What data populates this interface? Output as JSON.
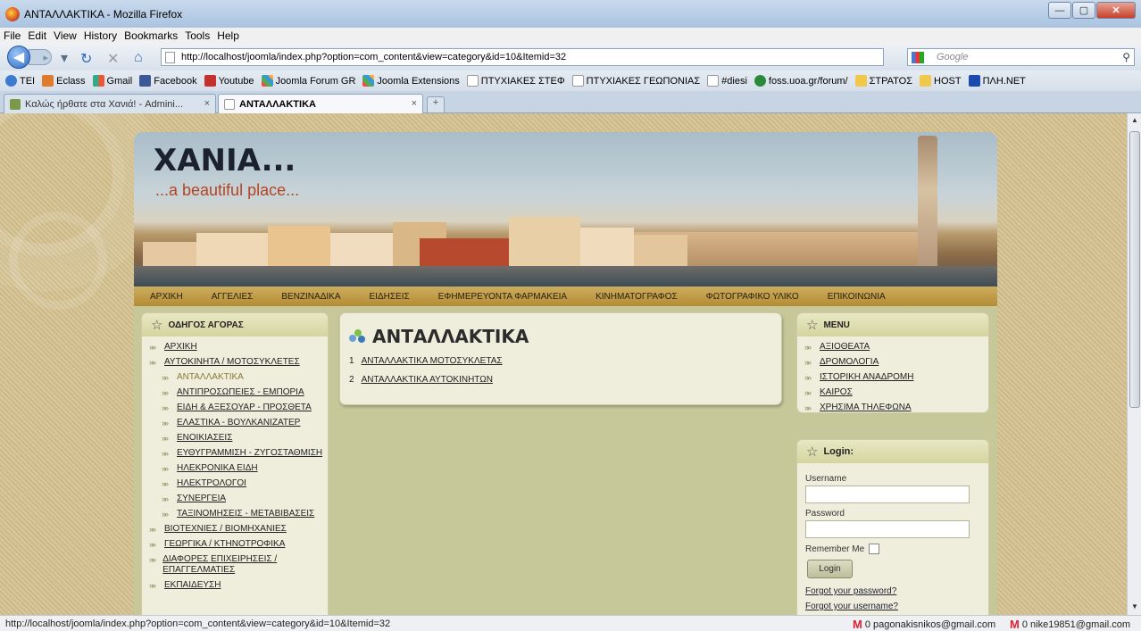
{
  "window": {
    "title": "ΑΝΤΑΛΛΑΚΤΙΚΑ - Mozilla Firefox"
  },
  "menubar": [
    "File",
    "Edit",
    "View",
    "History",
    "Bookmarks",
    "Tools",
    "Help"
  ],
  "nav": {
    "url": "http://localhost/joomla/index.php?option=com_content&view=category&id=10&Itemid=32",
    "search_placeholder": "Google"
  },
  "bookmarks": [
    {
      "label": "TEI",
      "icon": "blue-globe-icon"
    },
    {
      "label": "Eclass",
      "icon": "eclass-icon"
    },
    {
      "label": "Gmail",
      "icon": "gmail-icon"
    },
    {
      "label": "Facebook",
      "icon": "facebook-icon"
    },
    {
      "label": "Youtube",
      "icon": "youtube-icon"
    },
    {
      "label": "Joomla Forum GR",
      "icon": "joomla-icon"
    },
    {
      "label": "Joomla Extensions",
      "icon": "joomla-icon"
    },
    {
      "label": "ΠΤΥΧΙΑΚΕΣ ΣΤΕΦ",
      "icon": "page-icon"
    },
    {
      "label": "ΠΤΥΧΙΑΚΕΣ ΓΕΩΠΟΝΙΑΣ",
      "icon": "page-icon"
    },
    {
      "label": "#diesi",
      "icon": "page-icon"
    },
    {
      "label": "foss.uoa.gr/forum/",
      "icon": "foss-icon"
    },
    {
      "label": "ΣΤΡΑΤΟΣ",
      "icon": "folder-icon"
    },
    {
      "label": "HOST",
      "icon": "folder-icon"
    },
    {
      "label": "ΠΛΗ.ΝΕΤ",
      "icon": "fl-icon"
    }
  ],
  "tabs": [
    {
      "label": "Καλώς ήρθατε στα Χανιά! - Admini...",
      "active": false
    },
    {
      "label": "ΑΝΤΑΛΛΑΚΤΙΚΑ",
      "active": true
    }
  ],
  "site": {
    "title": "XANIA...",
    "subtitle": "...a beautiful place...",
    "topnav": [
      "ΑΡΧΙΚΗ",
      "ΑΓΓΕΛΙΕΣ",
      "ΒΕΝΖΙΝΑΔΙΚΑ",
      "ΕΙΔΗΣΕΙΣ",
      "ΕΦΗΜΕΡΕΥΟΝΤΑ ΦΑΡΜΑΚΕΙΑ",
      "ΚΙΝΗΜΑΤΟΓΡΑΦΟΣ",
      "ΦΩΤΟΓΡΑΦΙΚΟ ΥΛΙΚΟ",
      "ΕΠΙΚΟΙΝΩΝΙΑ"
    ]
  },
  "left_menu": {
    "title": "ΟΔΗΓΟΣ ΑΓΟΡΑΣ",
    "items": [
      {
        "label": "ΑΡΧΙΚΗ",
        "level": 0
      },
      {
        "label": "ΑΥΤΟΚΙΝΗΤΑ / ΜΟΤΟΣΥΚΛΕΤΕΣ",
        "level": 0
      },
      {
        "label": "ΑΝΤΑΛΛΑΚΤΙΚΑ",
        "level": 1,
        "active": true
      },
      {
        "label": "ΑΝΤΙΠΡΟΣΩΠΕΙΕΣ - ΕΜΠΟΡΙΑ",
        "level": 1
      },
      {
        "label": "ΕΙΔΗ & ΑΞΕΣΟΥΑΡ - ΠΡΟΣΘΕΤΑ",
        "level": 1
      },
      {
        "label": "ΕΛΑΣΤΙΚΑ - ΒΟΥΛΚΑΝΙΖΑΤΕΡ",
        "level": 1
      },
      {
        "label": "ΕΝΟΙΚΙΑΣΕΙΣ",
        "level": 1
      },
      {
        "label": "ΕΥΘΥΓΡΑΜΜΙΣΗ - ΖΥΓΟΣΤΑΘΜΙΣΗ",
        "level": 1
      },
      {
        "label": "ΗΛΕΚΡΟΝΙΚΑ ΕΙΔΗ",
        "level": 1
      },
      {
        "label": "ΗΛΕΚΤΡΟΛΟΓΟΙ",
        "level": 1
      },
      {
        "label": "ΣΥΝΕΡΓΕΙΑ",
        "level": 1
      },
      {
        "label": "ΤΑΞΙΝΟΜΗΣΕΙΣ - ΜΕΤΑΒΙΒΑΣΕΙΣ",
        "level": 1
      },
      {
        "label": "ΒΙΟΤΕΧΝΙΕΣ / ΒΙΟΜΗΧΑΝΙΕΣ",
        "level": 0
      },
      {
        "label": "ΓΕΩΡΓΙΚΑ / ΚΤΗΝΟΤΡΟΦΙΚΑ",
        "level": 0
      },
      {
        "label": "ΔΙΑΦΟΡΕΣ ΕΠΙΧΕΙΡΗΣΕΙΣ / ΕΠΑΓΓΕΛΜΑΤΙΕΣ",
        "level": 0
      },
      {
        "label": "ΕΚΠΑΙΔΕΥΣΗ",
        "level": 0
      }
    ]
  },
  "content": {
    "title": "ΑΝΤΑΛΛΑΚΤΙΚΑ",
    "items": [
      {
        "num": "1",
        "label": "ΑΝΤΑΛΛΑΚΤΙΚΑ ΜΟΤΟΣΥΚΛΕΤΑΣ"
      },
      {
        "num": "2",
        "label": "ΑΝΤΑΛΛΑΚΤΙΚΑ ΑΥΤΟΚΙΝΗΤΩΝ"
      }
    ]
  },
  "right_menu": {
    "title": "MENU",
    "items": [
      "ΑΞΙΟΘΕΑΤΑ",
      "ΔΡΟΜΟΛΟΓΙΑ",
      "ΙΣΤΟΡΙΚΗ ΑΝΑΔΡΟΜΗ",
      "ΚΑΙΡΟΣ",
      "ΧΡΗΣΙΜΑ ΤΗΛΕΦΩΝΑ"
    ]
  },
  "login": {
    "title": "Login:",
    "username_label": "Username",
    "password_label": "Password",
    "remember_label": "Remember Me",
    "button": "Login",
    "forgot_password": "Forgot your password?",
    "forgot_username": "Forgot your username?"
  },
  "statusbar": {
    "url": "http://localhost/joomla/index.php?option=com_content&view=category&id=10&Itemid=32",
    "mail1": "0 pagonakisnikos@gmail.com",
    "mail2": "0 nike19851@gmail.com"
  }
}
